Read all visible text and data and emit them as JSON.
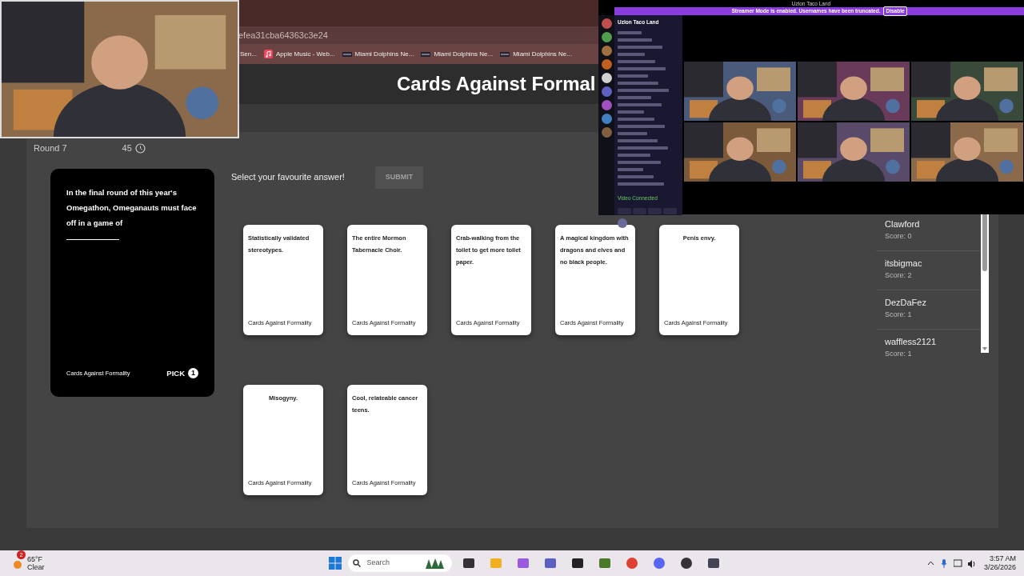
{
  "browser": {
    "address": "efea31cba64363c3e24",
    "bookmarks": [
      {
        "label": "Sen..."
      },
      {
        "label": "Apple Music - Web..."
      },
      {
        "label": "Miami Dolphins Ne..."
      },
      {
        "label": "Miami Dolphins Ne..."
      },
      {
        "label": "Miami Dolphins Ne..."
      }
    ]
  },
  "page": {
    "title": "Cards Against Formal",
    "round": "Round 7",
    "timer": "45",
    "prompt": "Select your favourite answer!",
    "submit": {
      "label": "SUBMIT",
      "disabled": true
    }
  },
  "black_card": {
    "text": "In the final round of this year's Omegathon, Omeganauts must face off in a game of",
    "footer": "Cards Against Formality",
    "pick_label": "PICK",
    "pick_count": "1"
  },
  "white_cards": [
    {
      "text": "Statistically validated stereotypes.",
      "footer": "Cards Against Formality"
    },
    {
      "text": "The entire Mormon Tabernacle Choir.",
      "footer": "Cards Against Formality"
    },
    {
      "text": "Crab-walking from the toilet to get more toilet paper.",
      "footer": "Cards Against Formality"
    },
    {
      "text": "A magical kingdom with dragons and elves and no black people.",
      "footer": "Cards Against Formality"
    },
    {
      "text": "Penis envy.",
      "footer": "Cards Against Formality"
    },
    {
      "text": "Misogyny.",
      "footer": "Cards Against Formality"
    },
    {
      "text": "Cool, relateable cancer teens.",
      "footer": "Cards Against Formality"
    }
  ],
  "players": [
    {
      "name": "Clawford",
      "score": "Score: 0"
    },
    {
      "name": "itsbigmac",
      "score": "Score: 2"
    },
    {
      "name": "DezDaFez",
      "score": "Score: 1"
    },
    {
      "name": "waffless2121",
      "score": "Score: 1"
    }
  ],
  "discord": {
    "title": "Uzlon Taco Land",
    "banner": "Streamer Mode is enabled. Usernames have been truncated.",
    "banner_button": "Disable",
    "server": "Uzlon Taco Land",
    "voice_status": "Video Connected"
  },
  "taskbar": {
    "temperature": "65°F",
    "weather": "Clear",
    "weather_badge": "2",
    "search_placeholder": "Search",
    "time": "3:57 AM",
    "date": "3/26/2026"
  }
}
